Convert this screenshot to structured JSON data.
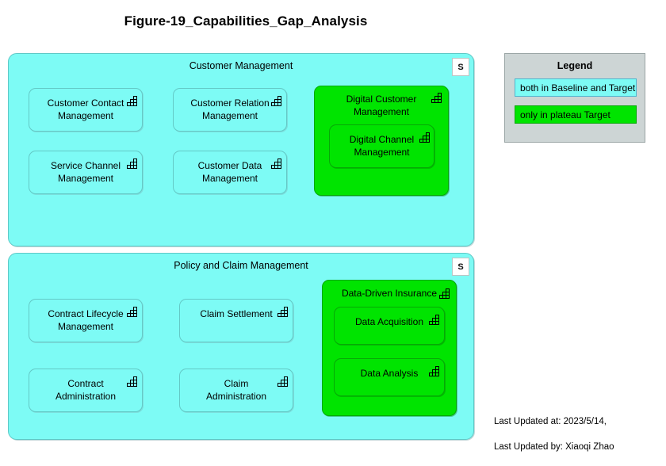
{
  "title": "Figure-19_Capabilities_Gap_Analysis",
  "icon_names": {
    "capability": "capability-staircase-icon"
  },
  "colors": {
    "baseline_and_target": "#7DFBF5",
    "only_in_target": "#00E400",
    "legend_background": "#CDD5D5",
    "page_background": "#FFFFFF"
  },
  "groups": [
    {
      "name": "Customer Management",
      "badge": "S",
      "fill": "#7DFBF5",
      "capabilities": [
        {
          "label": "Customer Contact\nManagement",
          "fill": "#7DFBF5"
        },
        {
          "label": "Customer Relation\nManagement",
          "fill": "#7DFBF5"
        },
        {
          "label": "Service Channel\nManagement",
          "fill": "#7DFBF5"
        },
        {
          "label": "Customer Data\nManagement",
          "fill": "#7DFBF5"
        },
        {
          "label": "Digital Customer\nManagement",
          "fill": "#00E400",
          "children": [
            {
              "label": "Digital Channel\nManagement",
              "fill": "#00E400"
            }
          ]
        }
      ]
    },
    {
      "name": "Policy and Claim Management",
      "badge": "S",
      "fill": "#7DFBF5",
      "capabilities": [
        {
          "label": "Contract Lifecycle\nManagement",
          "fill": "#7DFBF5"
        },
        {
          "label": "Claim Settlement",
          "fill": "#7DFBF5"
        },
        {
          "label": "Contract\nAdministration",
          "fill": "#7DFBF5"
        },
        {
          "label": "Claim\nAdministration",
          "fill": "#7DFBF5"
        },
        {
          "label": "Data-Driven Insurance",
          "fill": "#00E400",
          "children": [
            {
              "label": "Data Acquisition",
              "fill": "#00E400"
            },
            {
              "label": "Data Analysis",
              "fill": "#00E400"
            }
          ]
        }
      ]
    }
  ],
  "legend": {
    "title": "Legend",
    "items": [
      {
        "label": "both in Baseline and Target",
        "color": "#7DFBF5"
      },
      {
        "label": "only in plateau Target",
        "color": "#00E400"
      }
    ]
  },
  "footer": {
    "line1": "Last Updated at: 2023/5/14,",
    "line2": "Last Updated by: Xiaoqi Zhao"
  }
}
